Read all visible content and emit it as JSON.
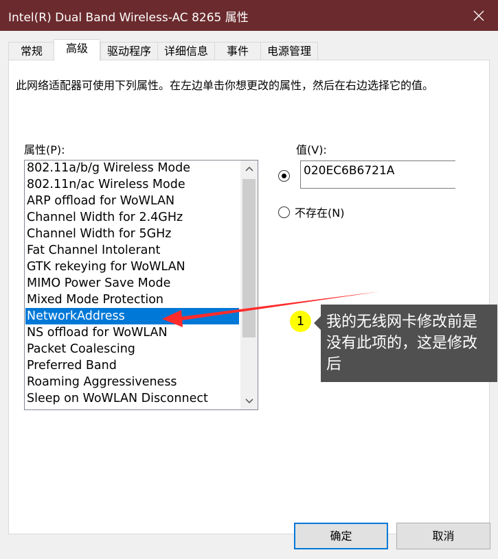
{
  "window": {
    "title": "Intel(R) Dual Band Wireless-AC 8265 属性",
    "close_icon": "close-icon"
  },
  "tabs": [
    {
      "label": "常规",
      "active": false
    },
    {
      "label": "高级",
      "active": true
    },
    {
      "label": "驱动程序",
      "active": false
    },
    {
      "label": "详细信息",
      "active": false
    },
    {
      "label": "事件",
      "active": false
    },
    {
      "label": "电源管理",
      "active": false
    }
  ],
  "advanced": {
    "description": "此网络适配器可使用下列属性。在左边单击你想更改的属性，然后在右边选择它的值。",
    "property_label": "属性(P):",
    "value_label": "值(V):",
    "properties": [
      "802.11a/b/g Wireless Mode",
      "802.11n/ac Wireless Mode",
      "ARP offload for WoWLAN",
      "Channel Width for 2.4GHz",
      "Channel Width for 5GHz",
      "Fat Channel Intolerant",
      "GTK rekeying for WoWLAN",
      "MIMO Power Save Mode",
      "Mixed Mode Protection",
      "NetworkAddress",
      "NS offload for WoWLAN",
      "Packet Coalescing",
      "Preferred Band",
      "Roaming Aggressiveness",
      "Sleep on WoWLAN Disconnect"
    ],
    "selected_property": "NetworkAddress",
    "value_input": "020EC6B6721A",
    "value_radio_selected": true,
    "not_present_label": "不存在(N)",
    "not_present_selected": false
  },
  "annotation": {
    "number": "1",
    "text": "我的无线网卡修改前是没有此项的，这是修改后",
    "color": "#ff2b2b",
    "badge_color": "#ffff00"
  },
  "buttons": {
    "ok": "确定",
    "cancel": "取消"
  },
  "colors": {
    "titlebar": "#6b2b2e",
    "selection": "#0078d7"
  }
}
